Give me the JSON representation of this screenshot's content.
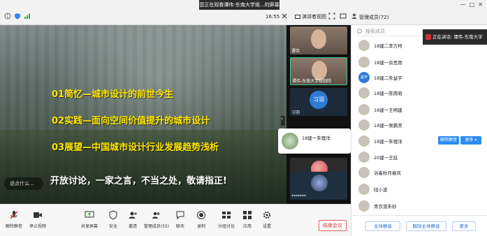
{
  "topbar": {
    "share_banner": "您正在观看谭伟-东南大学规...的屏幕",
    "time": "16:55",
    "view_label": "演讲者视图",
    "panel_title": "管理成员(72)"
  },
  "slide": {
    "line1": "01简忆—城市设计的前世今生",
    "line2": "02实践—面向空间价值提升的城市设计",
    "line3": "03展望—中国城市设计行业发展趋势浅析",
    "footer": "开放讨论，一家之言，不当之处，敬请指正!",
    "comment_placeholder": "说点什么..."
  },
  "thumbnails": [
    {
      "name": "谭伟"
    },
    {
      "name": "谭伟-东南大学规划院"
    },
    {
      "name": "习羽",
      "avatar_text": "习羽"
    },
    {
      "name": "18建一朱理洋"
    },
    {
      "name": "*******"
    },
    {
      "name": ""
    }
  ],
  "popover": {
    "name": "18建一朱理洋"
  },
  "tooltip": {
    "text": "正在讲话: 谭伟-东南大学"
  },
  "participants": {
    "search_placeholder": "搜索成员",
    "items": [
      {
        "name": "18建二李万柯"
      },
      {
        "name": "18建一俞思雨"
      },
      {
        "name": "18建二朱益宇",
        "avatar_text": "益宇"
      },
      {
        "name": "18建一陈雨萌"
      },
      {
        "name": "18建一王明建"
      },
      {
        "name": "18建一吴鹏昊"
      },
      {
        "name": "18建一朱理洋"
      },
      {
        "name": "20建一王廷"
      },
      {
        "name": "浴着秋月春风"
      },
      {
        "name": "陆小波"
      },
      {
        "name": "青衣落朱砂"
      }
    ],
    "mute_button": "解除静音",
    "more_button": "更多 ▾",
    "mute_all": "全体静音",
    "unmute_all": "解除全体静音",
    "more": "更多"
  },
  "toolbar": {
    "unmute": "解除静音",
    "stop_video": "停止视频",
    "share_screen": "共享屏幕",
    "security": "安全",
    "invite": "邀请",
    "manage": "管理成员(55)",
    "chat": "聊天",
    "record": "录制",
    "breakout": "分组讨论",
    "apps": "应用",
    "settings": "设置",
    "end_meeting": "结束会议"
  },
  "colors": {
    "accent": "#2d8cf0",
    "slide_text": "#ffe600",
    "danger": "#d33"
  }
}
